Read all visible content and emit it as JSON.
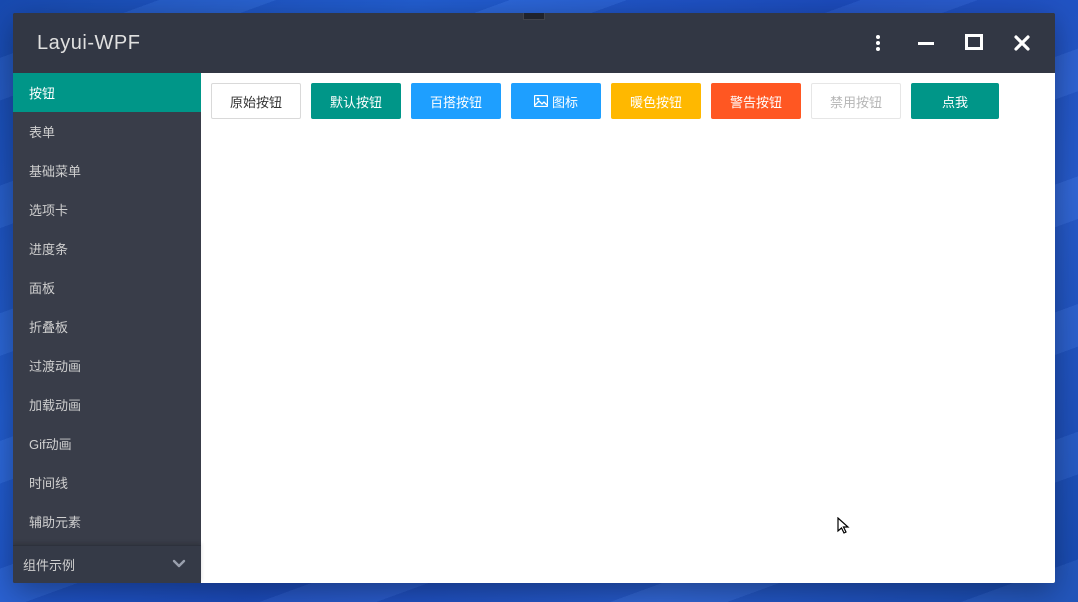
{
  "window": {
    "title": "Layui-WPF"
  },
  "sidebar": {
    "items": [
      {
        "label": "按钮",
        "active": true
      },
      {
        "label": "表单",
        "active": false
      },
      {
        "label": "基础菜单",
        "active": false
      },
      {
        "label": "选项卡",
        "active": false
      },
      {
        "label": "进度条",
        "active": false
      },
      {
        "label": "面板",
        "active": false
      },
      {
        "label": "折叠板",
        "active": false
      },
      {
        "label": "过渡动画",
        "active": false
      },
      {
        "label": "加载动画",
        "active": false
      },
      {
        "label": "Gif动画",
        "active": false
      },
      {
        "label": "时间线",
        "active": false
      },
      {
        "label": "辅助元素",
        "active": false
      }
    ],
    "footer": {
      "label": "组件示例"
    }
  },
  "buttons": {
    "raw": "原始按钮",
    "default": "默认按钮",
    "normal": "百搭按钮",
    "icon": "图标",
    "warm": "暖色按钮",
    "danger": "警告按钮",
    "disabled": "禁用按钮",
    "click": "点我"
  }
}
